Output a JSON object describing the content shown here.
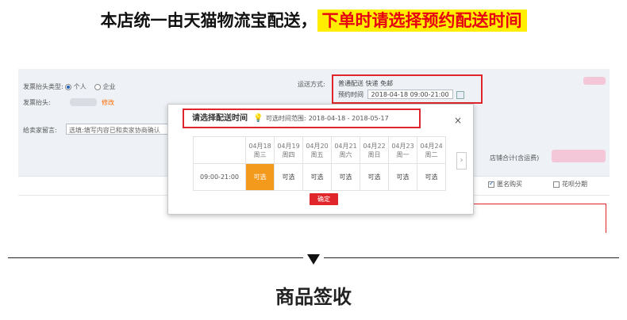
{
  "headline": {
    "main": "本店统一由天猫物流宝配送，",
    "highlight": "下单时请选择预约配送时间"
  },
  "form": {
    "invoice_type_label": "发票抬头类型:",
    "invoice_personal": "个人",
    "invoice_company": "企业",
    "invoice_title_label": "发票抬头:",
    "modify_link": "修改",
    "message_label": "给卖家留言:",
    "message_value": "选填:填写内容已和卖家协商确认",
    "shipping_label": "运送方式:",
    "shipping_value": "普通配送 快递 免邮",
    "appoint_label": "预约时间",
    "appoint_value": "2018-04-18 09:00-21:00",
    "shop_total_label": "店铺合计(含运费)",
    "anonymous_label": "匿名购买",
    "huabei_label": "花呗分期"
  },
  "popup": {
    "title": "请选择配送时间",
    "range_label": "可选时间范围:",
    "range_value": "2018-04-18 - 2018-05-17",
    "close_icon": "close-icon",
    "days": [
      {
        "date": "04月18",
        "weekday": "周三"
      },
      {
        "date": "04月19",
        "weekday": "周四"
      },
      {
        "date": "04月20",
        "weekday": "周五"
      },
      {
        "date": "04月21",
        "weekday": "周六"
      },
      {
        "date": "04月22",
        "weekday": "周日"
      },
      {
        "date": "04月23",
        "weekday": "周一"
      },
      {
        "date": "04月24",
        "weekday": "周二"
      }
    ],
    "time_slot": "09:00-21:00",
    "slot_labels": [
      "可选",
      "可选",
      "可选",
      "可选",
      "可选",
      "可选",
      "可选"
    ],
    "selected_index": 0,
    "selected_color": "#f39a1c",
    "confirm": "确定"
  },
  "section": {
    "title": "商品签收"
  },
  "colors": {
    "accent_red": "#e0262a",
    "highlight_yellow": "#ffee00",
    "selected_orange": "#f39a1c"
  }
}
